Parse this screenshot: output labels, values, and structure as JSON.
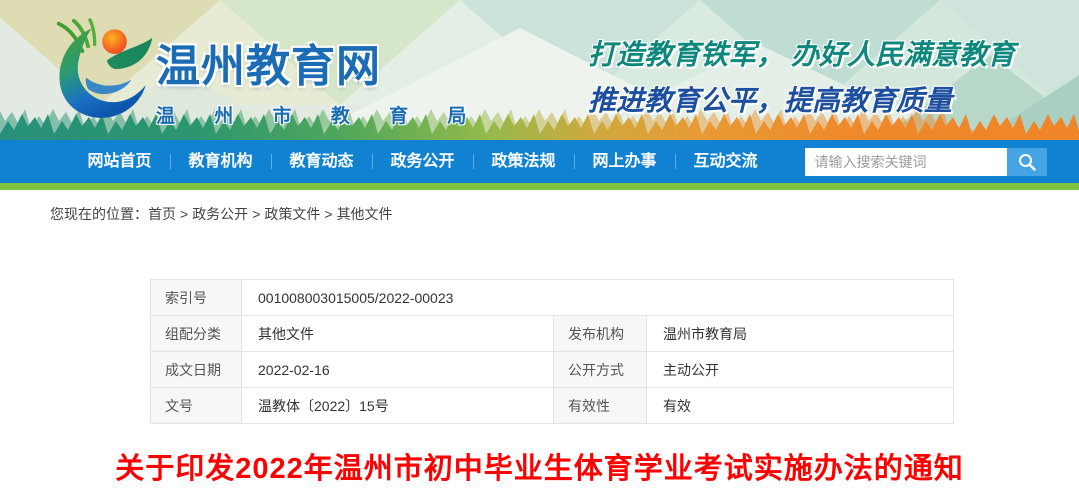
{
  "colors": {
    "nav_bg": "#1182d2",
    "search_btn_bg": "#47a4e4",
    "strip_green": "#7fc343",
    "site_title_blue": "#1b6cb5",
    "slogan_teal": "#0e877d",
    "slogan_blue": "#1d4f9e",
    "doc_title_red": "#ff0000",
    "label_cell_bg": "#f7f7f7"
  },
  "header": {
    "logo_icon": "wenzhou-education-logo",
    "site_title": "温州教育网",
    "site_subtitle": "温 州 市 教 育 局",
    "slogan_line1": "打造教育铁军， 办好人民满意教育",
    "slogan_line2": "推进教育公平，提高教育质量"
  },
  "nav": {
    "items": [
      {
        "label": "网站首页"
      },
      {
        "label": "教育机构"
      },
      {
        "label": "教育动态"
      },
      {
        "label": "政务公开"
      },
      {
        "label": "政策法规"
      },
      {
        "label": "网上办事"
      },
      {
        "label": "互动交流"
      }
    ],
    "search": {
      "placeholder": "请输入搜索关键词",
      "button_icon": "search-icon"
    }
  },
  "breadcrumb": {
    "prefix": "您现在的位置：",
    "separator": ">",
    "items": [
      "首页",
      "政务公开",
      "政策文件",
      "其他文件"
    ]
  },
  "doc_info": {
    "rows": [
      {
        "cells": [
          {
            "label": "索引号",
            "value": "001008003015005/2022-00023",
            "span": 3
          }
        ]
      },
      {
        "cells": [
          {
            "label": "组配分类",
            "value": "其他文件"
          },
          {
            "label": "发布机构",
            "value": "温州市教育局"
          }
        ]
      },
      {
        "cells": [
          {
            "label": "成文日期",
            "value": "2022-02-16"
          },
          {
            "label": "公开方式",
            "value": "主动公开"
          }
        ]
      },
      {
        "cells": [
          {
            "label": "文号",
            "value": "温教体〔2022〕15号"
          },
          {
            "label": "有效性",
            "value": "有效"
          }
        ]
      }
    ]
  },
  "document": {
    "title": "关于印发2022年温州市初中毕业生体育学业考试实施办法的通知"
  }
}
